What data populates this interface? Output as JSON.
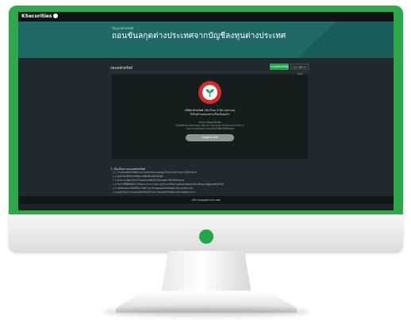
{
  "site": {
    "logo_text": "KSecurities",
    "breadcrumb": "ข้อมูลหลักทรัพย์",
    "title": "ถอนขันลกุดต่างประเทศจากบัญชีลงทุนต่างประเทศ",
    "section_label": "ถอนหลักทรัพย์",
    "tabs": [
      {
        "label": "ถอนหลักทรัพย์",
        "active": true
      },
      {
        "label": "ประวัติการถอน",
        "active": false
      }
    ],
    "card": {
      "line1": "บริษัทหลักทรัพย์ กสิกรไทย จำกัด (มหาชน)",
      "line2": "ได้รับคำขอของท่านเรียบร้อยแล้ว",
      "note1": "สอบถามข้อมูลเพิ่มเติม",
      "note2": "โทรศัพท์ 02 696 0000 หรือ 02 796 0000 ในวันและเวลาทำการ",
      "note3": "ระยะเวลาดำเนินการตามเงื่อนไขที่บริษัทกำหนด",
      "button_label": "กลับสู่หน้าหลัก"
    },
    "conditions": {
      "heading": "1. เงื่อนไขการถอนหลักทรัพย์",
      "items": [
        "1.1 การถอนหลักทรัพย์ต่างประเทศจะต้องระบุข้อมูลโบรกเกอร์ปลายทางให้ครบถ้วน",
        "1.2 ลูกค้าต้องมีหลักทรัพย์คงเหลือเพียงพอในบัญชี",
        "1.3 ค่าธรรมเนียมในการโอนหลักทรัพย์เป็นไปตามอัตราที่บริษัทกำหนด",
        "1.4 ในกรณีที่มีสิทธิประโยชน์ระหว่างการโอน ลูกค้าจะได้รับตามเงื่อนไขของนายทะเบียนและผู้ดูแลหลักทรัพย์",
        "1.5 บริษัทขอสงวนสิทธิ์ในการพิจารณาคำขอถอนหลักทรัพย์ตามความเหมาะสม",
        "1.6 ลูกค้ารับทราบและยอมรับเงื่อนไขในการถอนหลักทรัพย์ต่างประเทศทุกประการ"
      ]
    },
    "footer_text": "บริการลงทุนต่างประเทศ"
  },
  "colors": {
    "bezel": "#2ea84a",
    "hero": "#1f6a64",
    "accent": "#28a24e",
    "seal": "#d62b2b"
  },
  "icons": {
    "logo": "kasikorn-logo-icon",
    "seal": "kasikorn-seal-icon",
    "power": "power-indicator-icon"
  }
}
